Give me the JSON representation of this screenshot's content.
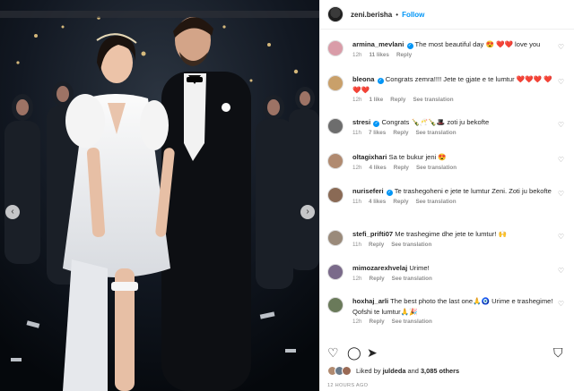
{
  "header": {
    "username": "zeni.berisha",
    "separator": "•",
    "follow_label": "Follow",
    "options_icon": "more-horizontal-icon"
  },
  "comments": [
    {
      "user": "armina_mevlani",
      "verified": true,
      "text": "The most beautiful day 😍 ❤️❤️ love you",
      "time": "12h",
      "likes": "11 likes",
      "reply": "Reply",
      "translation": "",
      "avatar_color": "#d99ca8"
    },
    {
      "user": "bleona",
      "verified": true,
      "text": "Congrats zemra!!!! Jete te gjate e te lumtur ❤️❤️❤️ ❤️❤️❤️",
      "time": "12h",
      "likes": "1 like",
      "reply": "Reply",
      "translation": "See translation",
      "avatar_color": "#c9a06a"
    },
    {
      "user": "stresi",
      "verified": true,
      "text": "Congrats 🍾🥂🍾🎩 zoti ju bekofte",
      "time": "11h",
      "likes": "7 likes",
      "reply": "Reply",
      "translation": "See translation",
      "avatar_color": "#6d6d6d"
    },
    {
      "user": "oltagixhari",
      "verified": false,
      "text": "Sa te bukur jeni 😍",
      "time": "12h",
      "likes": "4 likes",
      "reply": "Reply",
      "translation": "See translation",
      "avatar_color": "#b08a70"
    },
    {
      "user": "nuriseferi",
      "verified": true,
      "text": "Te trashegoheni e jete te lumtur Zeni. Zoti ju bekofte",
      "time": "11h",
      "likes": "4 likes",
      "reply": "Reply",
      "translation": "See translation",
      "avatar_color": "#8a6a55"
    },
    {
      "user": "stefi_prifti07",
      "verified": false,
      "text": "Me trashegime dhe jete te lumtur! 🙌",
      "time": "11h",
      "likes": "",
      "reply": "Reply",
      "translation": "See translation",
      "avatar_color": "#9a8a7a"
    },
    {
      "user": "mimozarexhvelaj",
      "verified": false,
      "text": "Urime!",
      "time": "12h",
      "likes": "",
      "reply": "Reply",
      "translation": "See translation",
      "avatar_color": "#7a6a8a"
    },
    {
      "user": "hoxhaj_arli",
      "verified": false,
      "text": "The best photo the last one🙏🧿 Urime e trashegime! Qofshi te lumtur🙏🎉",
      "time": "12h",
      "likes": "",
      "reply": "Reply",
      "translation": "See translation",
      "avatar_color": "#6a7a5a"
    }
  ],
  "actions": {
    "like_icon": "heart-icon",
    "comment_icon": "comment-icon",
    "share_icon": "share-icon",
    "save_icon": "bookmark-icon"
  },
  "likes": {
    "prefix": "Liked by",
    "user": "juldeda",
    "connector": "and",
    "count": "3,085 others"
  },
  "timestamp": "12 HOURS AGO",
  "colors": {
    "accent": "#0095f6",
    "muted": "#8e8e8e",
    "text": "#262626"
  }
}
